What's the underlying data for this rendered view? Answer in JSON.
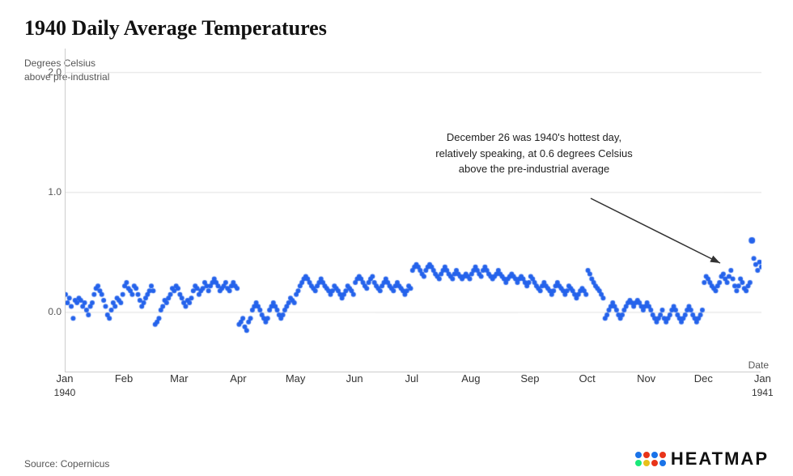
{
  "title": "1940 Daily Average Temperatures",
  "y_axis_label_line1": "Degrees Celsius",
  "y_axis_label_line2": "above pre-industrial",
  "y_ticks": [
    {
      "value": 2.0,
      "label": "2.0"
    },
    {
      "value": 1.0,
      "label": "1.0"
    },
    {
      "value": 0.0,
      "label": "0.0"
    }
  ],
  "x_labels": [
    {
      "label": "Jan",
      "year": "1940",
      "month_index": 0
    },
    {
      "label": "Feb",
      "year": "",
      "month_index": 1
    },
    {
      "label": "Mar",
      "year": "",
      "month_index": 2
    },
    {
      "label": "Apr",
      "year": "",
      "month_index": 3
    },
    {
      "label": "May",
      "year": "",
      "month_index": 4
    },
    {
      "label": "Jun",
      "year": "",
      "month_index": 5
    },
    {
      "label": "Jul",
      "year": "",
      "month_index": 6
    },
    {
      "label": "Aug",
      "year": "",
      "month_index": 7
    },
    {
      "label": "Sep",
      "year": "",
      "month_index": 8
    },
    {
      "label": "Oct",
      "year": "",
      "month_index": 9
    },
    {
      "label": "Nov",
      "year": "",
      "month_index": 10
    },
    {
      "label": "Dec",
      "year": "",
      "month_index": 11
    },
    {
      "label": "Jan",
      "year": "1941",
      "month_index": 12
    }
  ],
  "date_axis_label": "Date",
  "annotation_text": "December 26 was 1940's hottest day,\nrelatively speaking, at 0.6 degrees Celsius\nabove the pre-industrial average",
  "source": "Source: Copernicus",
  "logo_text": "HEATMAP",
  "dot_colors": [
    "#1a73e8",
    "#e8341a",
    "#1a73e8",
    "#e8341a",
    "#1ae8a0",
    "#e8c01a",
    "#e8341a",
    "#1a73e8"
  ],
  "data_points": [
    0.15,
    0.08,
    0.12,
    0.05,
    -0.05,
    0.1,
    0.08,
    0.12,
    0.1,
    0.05,
    0.08,
    0.02,
    -0.02,
    0.05,
    0.08,
    0.15,
    0.2,
    0.22,
    0.18,
    0.15,
    0.1,
    0.05,
    -0.02,
    -0.05,
    0.02,
    0.08,
    0.05,
    0.12,
    0.1,
    0.08,
    0.15,
    0.22,
    0.25,
    0.2,
    0.18,
    0.15,
    0.22,
    0.2,
    0.15,
    0.1,
    0.05,
    0.08,
    0.12,
    0.15,
    0.18,
    0.22,
    0.18,
    -0.1,
    -0.08,
    -0.05,
    0.02,
    0.05,
    0.1,
    0.08,
    0.12,
    0.15,
    0.2,
    0.18,
    0.22,
    0.2,
    0.15,
    0.12,
    0.08,
    0.05,
    0.1,
    0.08,
    0.12,
    0.18,
    0.22,
    0.2,
    0.15,
    0.18,
    0.2,
    0.25,
    0.22,
    0.18,
    0.22,
    0.25,
    0.28,
    0.25,
    0.22,
    0.18,
    0.2,
    0.22,
    0.25,
    0.2,
    0.18,
    0.22,
    0.2,
    0.18,
    0.15,
    0.12,
    0.1,
    0.15,
    0.18,
    0.2,
    0.22,
    0.25,
    0.22,
    0.2,
    0.18,
    0.22,
    0.25,
    0.22,
    0.2,
    0.25,
    0.22,
    0.2,
    0.18,
    0.15,
    0.12,
    0.1,
    0.08,
    0.05,
    0.08,
    0.12,
    0.15,
    0.18,
    0.2,
    0.18,
    0.15,
    0.12,
    0.08,
    0.05,
    0.02,
    0.35,
    0.15,
    0.05,
    0.02,
    -0.02,
    -0.05,
    -0.02,
    0.02,
    0.05,
    0.08,
    -0.05,
    -0.08,
    -0.05,
    0.02,
    0.05,
    0.02,
    -0.02,
    -0.05,
    -0.08,
    -0.05,
    0.02,
    0.05,
    0.08,
    0.05,
    0.02,
    -0.02,
    -0.05,
    -0.02,
    0.02,
    0.05,
    0.25,
    0.3,
    0.28,
    0.25,
    0.22,
    0.2,
    0.18,
    0.22,
    0.25,
    0.3,
    0.32,
    0.28,
    0.25,
    0.3,
    0.35,
    0.28,
    0.22,
    0.18,
    0.22,
    0.28,
    0.25,
    0.2,
    0.18,
    0.22,
    0.25,
    0.6,
    0.45,
    0.4,
    0.35,
    0.42,
    0.38,
    0.3,
    0.25,
    0.35,
    0.4,
    0.42
  ]
}
